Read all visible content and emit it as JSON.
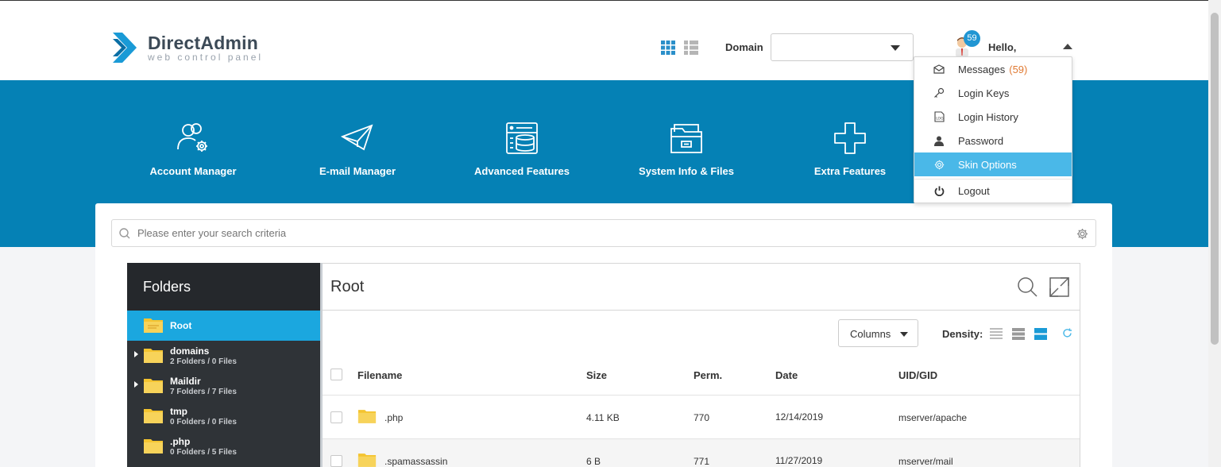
{
  "header": {
    "logo_title": "DirectAdmin",
    "logo_subtitle": "web control panel",
    "domain_label": "Domain",
    "domain_value": "",
    "notification_count": "59",
    "greeting": "Hello,"
  },
  "nav": [
    {
      "label": "Account Manager",
      "icon": "account-manager-icon"
    },
    {
      "label": "E-mail Manager",
      "icon": "paper-plane-icon"
    },
    {
      "label": "Advanced Features",
      "icon": "server-database-icon"
    },
    {
      "label": "System Info & Files",
      "icon": "file-cabinet-icon"
    },
    {
      "label": "Extra Features",
      "icon": "plus-icon"
    }
  ],
  "user_menu": {
    "items": [
      {
        "label": "Messages",
        "count": "(59)",
        "icon": "envelope-icon"
      },
      {
        "label": "Login Keys",
        "icon": "key-icon"
      },
      {
        "label": "Login History",
        "icon": "log-icon"
      },
      {
        "label": "Password",
        "icon": "user-icon"
      },
      {
        "label": "Skin Options",
        "icon": "gear-icon",
        "active": true
      },
      {
        "label": "Logout",
        "icon": "power-icon"
      }
    ]
  },
  "search": {
    "placeholder": "Please enter your search criteria"
  },
  "folders": {
    "title": "Folders",
    "items": [
      {
        "name": "Root",
        "meta": "",
        "active": true
      },
      {
        "name": "domains",
        "meta": "2 Folders / 0 Files",
        "expandable": true
      },
      {
        "name": "Maildir",
        "meta": "7 Folders / 7 Files",
        "expandable": true
      },
      {
        "name": "tmp",
        "meta": "0 Folders / 0 Files"
      },
      {
        "name": ".php",
        "meta": "0 Folders / 5 Files"
      }
    ]
  },
  "files": {
    "title": "Root",
    "columns_label": "Columns",
    "density_label": "Density:",
    "headers": {
      "filename": "Filename",
      "size": "Size",
      "perm": "Perm.",
      "date": "Date",
      "uid": "UID/GID"
    },
    "rows": [
      {
        "filename": ".php",
        "size": "4.11 KB",
        "perm": "770",
        "date": "12/14/2019",
        "uid": "mserver/apache"
      },
      {
        "filename": ".spamassassin",
        "size": "6 B",
        "perm": "771",
        "date": "11/27/2019",
        "uid": "mserver/mail"
      }
    ]
  },
  "colors": {
    "brand_blue": "#0581b5",
    "active_blue": "#1ba7df",
    "menu_active": "#4ab8e8",
    "folder_yellow": "#f4c430",
    "count_orange": "#e07a33"
  }
}
